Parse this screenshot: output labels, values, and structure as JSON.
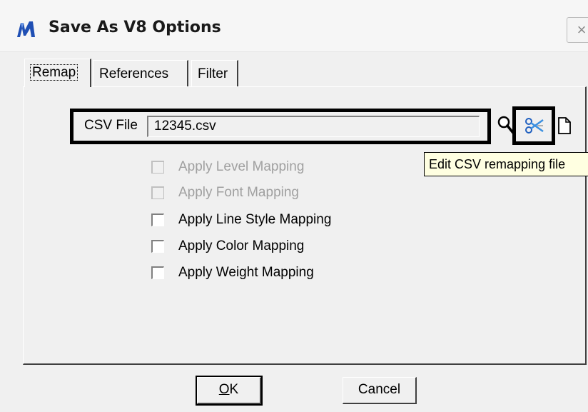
{
  "window": {
    "title": "Save As V8 Options",
    "close_glyph": "×",
    "app_icon": "microstation-m-icon"
  },
  "tabs": [
    {
      "label": "Remap",
      "active": true
    },
    {
      "label": "References",
      "active": false
    },
    {
      "label": "Filter",
      "active": false
    }
  ],
  "csv": {
    "label": "CSV File",
    "value": "12345.csv"
  },
  "tools": {
    "browse_icon": "magnifier-icon",
    "edit_icon": "edit-remap-icon",
    "new_icon": "new-file-icon"
  },
  "tooltip": {
    "text": "Edit CSV remapping file"
  },
  "options": [
    {
      "label": "Apply Level Mapping",
      "checked": false,
      "enabled": false
    },
    {
      "label": "Apply Font Mapping",
      "checked": false,
      "enabled": false
    },
    {
      "label": "Apply Line Style Mapping",
      "checked": false,
      "enabled": true
    },
    {
      "label": "Apply Color Mapping",
      "checked": false,
      "enabled": true
    },
    {
      "label": "Apply Weight Mapping",
      "checked": false,
      "enabled": true
    }
  ],
  "buttons": {
    "ok_mnemonic": "O",
    "ok_rest": "K",
    "cancel": "Cancel"
  }
}
